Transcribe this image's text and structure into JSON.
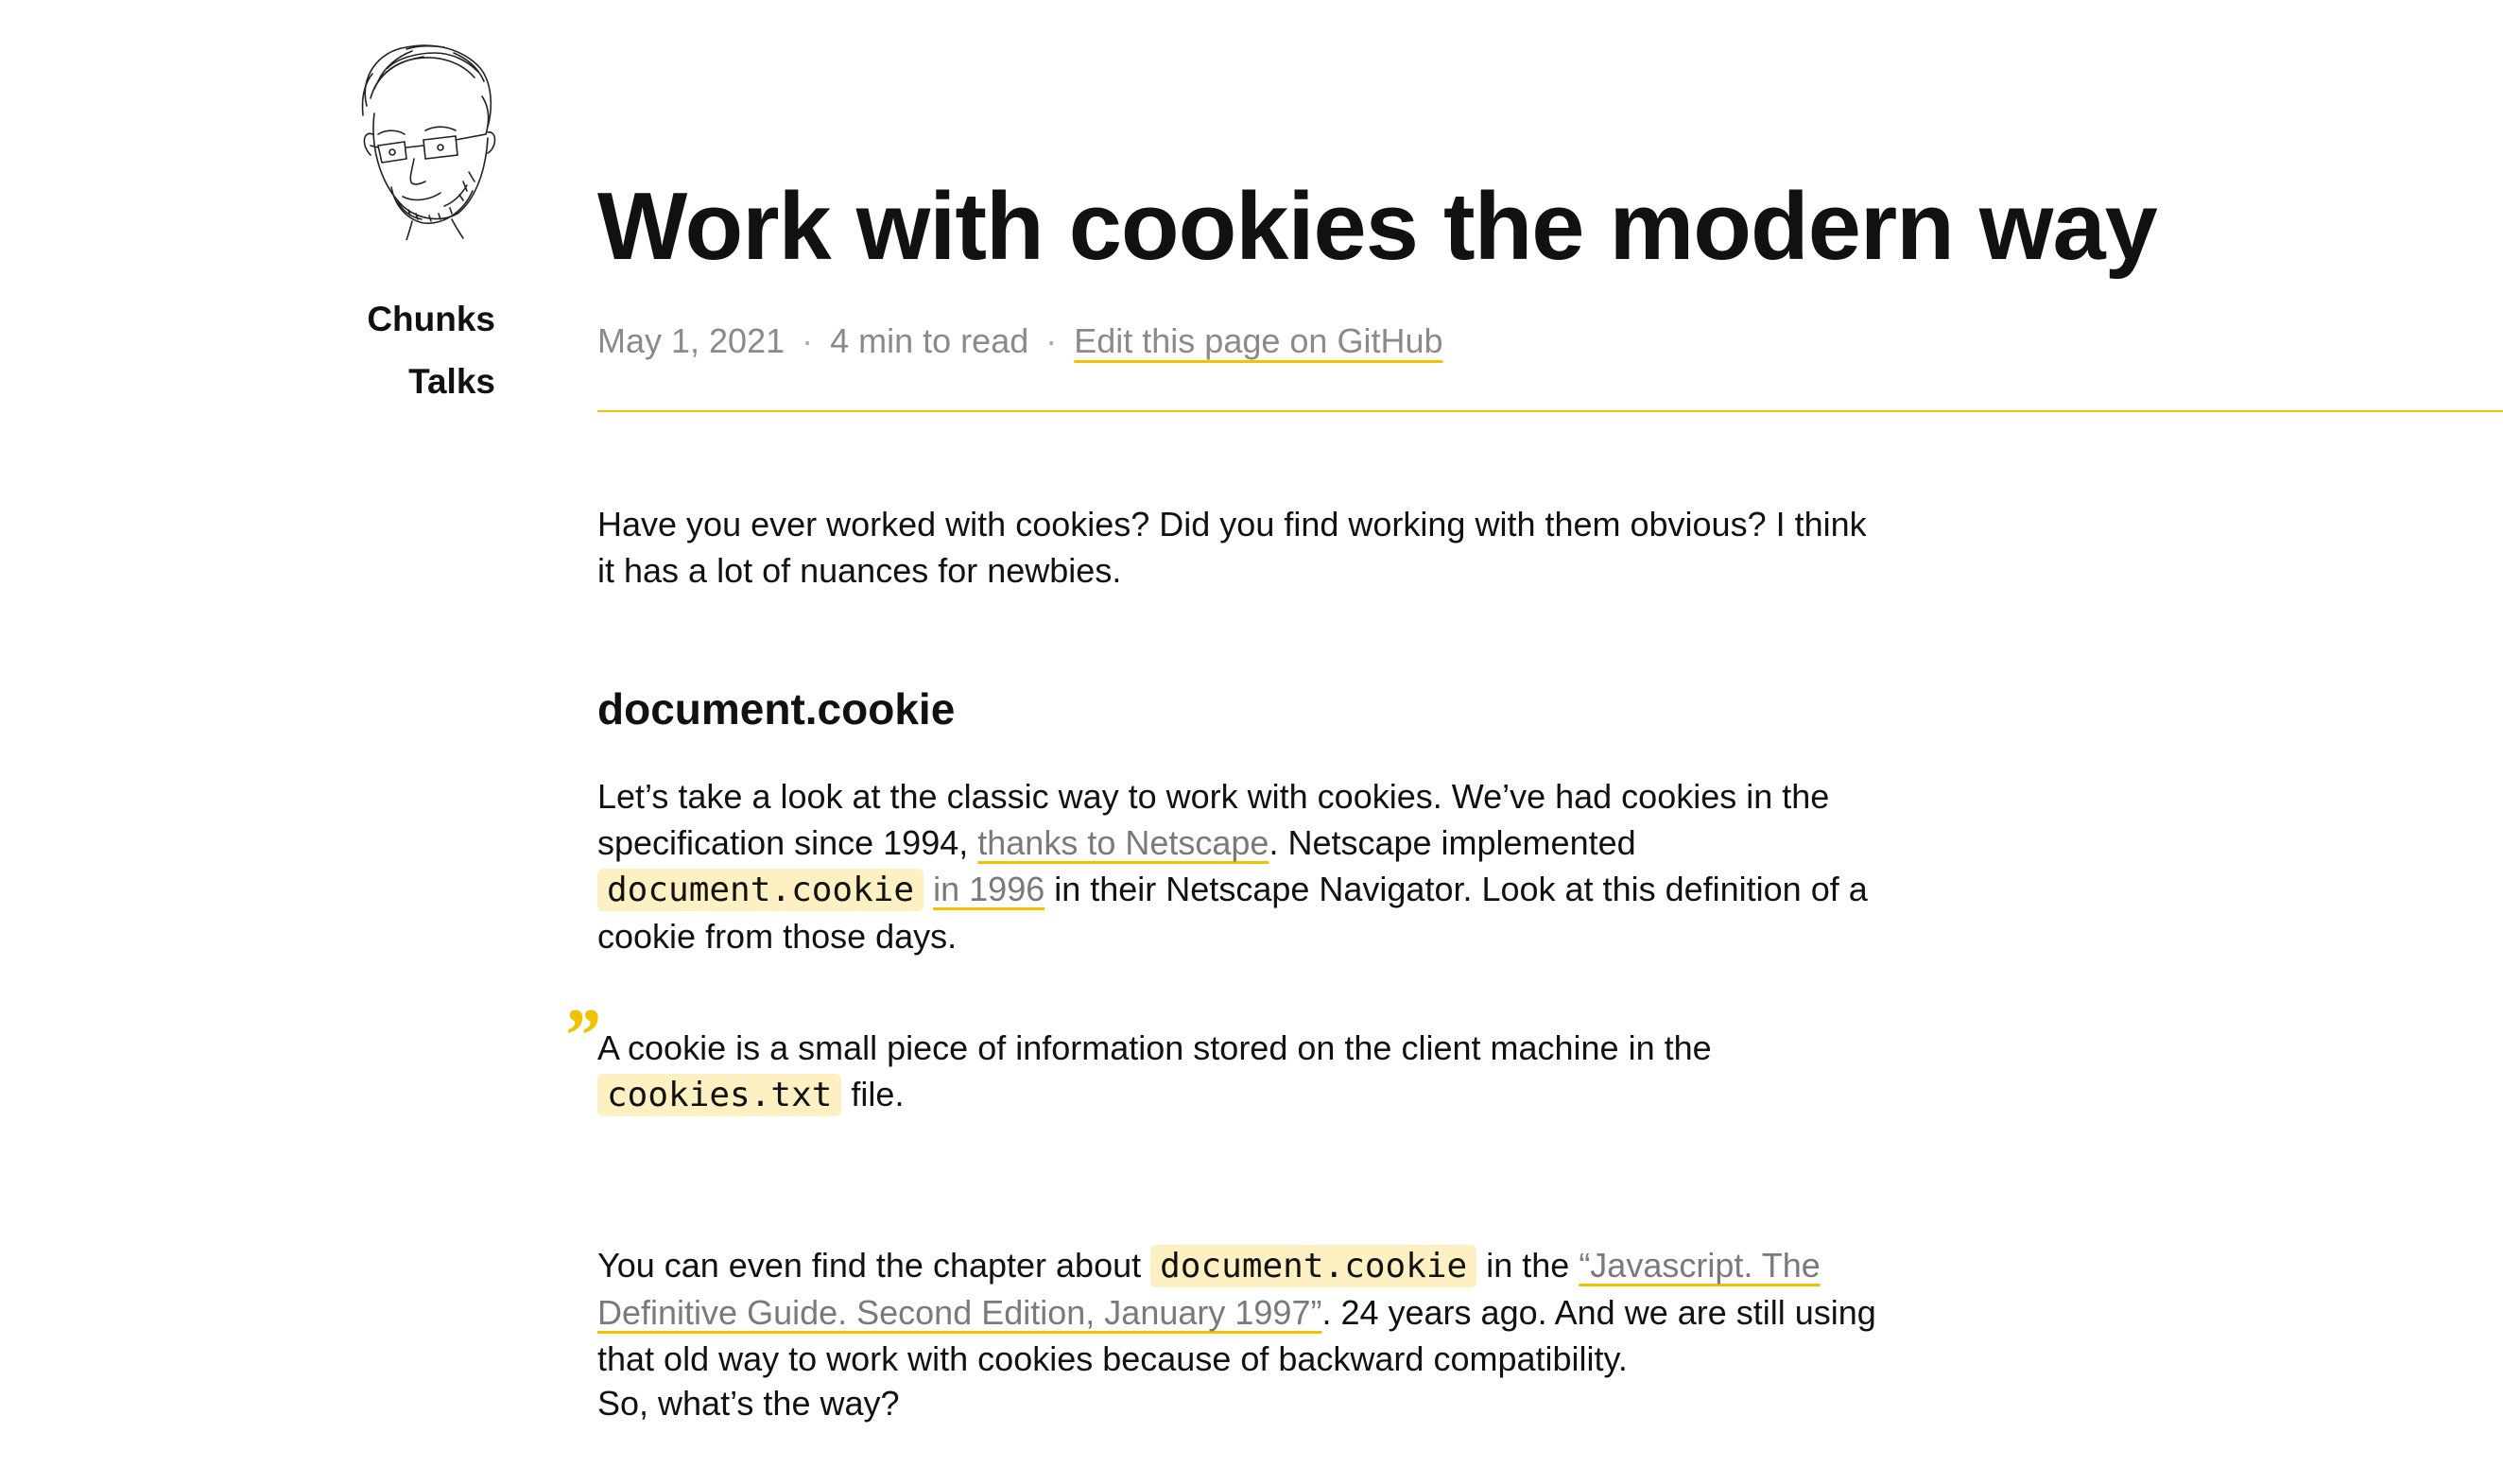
{
  "sidebar": {
    "avatar_alt": "Author portrait sketch",
    "nav": [
      {
        "label": "Chunks"
      },
      {
        "label": "Talks"
      }
    ]
  },
  "post": {
    "title": "Work with cookies the modern way",
    "date": "May 1, 2021",
    "read_time": "4 min to read",
    "separator": "·",
    "edit_link": "Edit this page on GitHub"
  },
  "article": {
    "intro": "Have you ever worked with cookies? Did you find working with them obvious? I think it has a lot of nuances for newbies.",
    "heading": "document.cookie",
    "classic": {
      "t1": "Let’s take a look at the classic way to work with cookies. We’ve had cookies in the specification since 1994, ",
      "link1": "thanks to Netscape",
      "t2": ". Netscape implemented ",
      "code1": "document.cookie",
      "t3": " ",
      "link2": "in 1996",
      "t4": " in their Netscape Navigator. Look at this definition of a cookie from those days."
    },
    "quote": {
      "mark": "”",
      "t1": "A cookie is a small piece of information stored on the client machine in the ",
      "code": "cookies.txt",
      "t2": " file."
    },
    "book": {
      "t1": "You can even find the chapter about ",
      "code": "document.cookie",
      "t2": " in the ",
      "link": "“Javascript. The Definitive Guide. Second Edition, January 1997”",
      "t3": ". 24 years ago. And we are still using that old way to work with cookies because of backward compatibility."
    },
    "closing": "So, what’s the way?"
  },
  "colors": {
    "accent": "#f2c200",
    "code_bg": "#fdf0c2",
    "meta_text": "#8a8a8a",
    "text": "#111111"
  }
}
